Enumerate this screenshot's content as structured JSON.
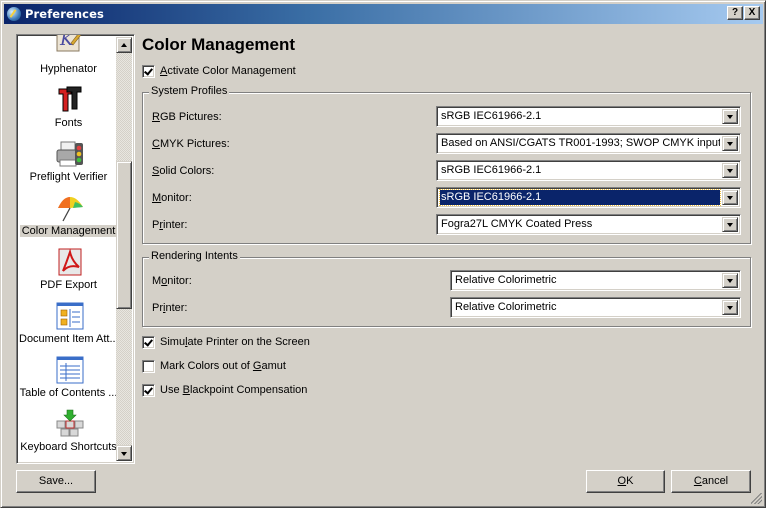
{
  "window": {
    "title": "Preferences",
    "help_button": "?",
    "close_button": "X"
  },
  "sidebar": {
    "items": [
      {
        "label": "Hyphenator",
        "icon": "hyphenator-icon"
      },
      {
        "label": "Fonts",
        "icon": "fonts-icon"
      },
      {
        "label": "Preflight Verifier",
        "icon": "preflight-verifier-icon"
      },
      {
        "label": "Color Management",
        "icon": "color-management-icon",
        "selected": true
      },
      {
        "label": "PDF Export",
        "icon": "pdf-export-icon"
      },
      {
        "label": "Document Item Att...",
        "icon": "document-item-attributes-icon"
      },
      {
        "label": "Table of Contents ...",
        "icon": "table-of-contents-icon"
      },
      {
        "label": "Keyboard Shortcuts",
        "icon": "keyboard-shortcuts-icon"
      }
    ]
  },
  "main": {
    "title": "Color Management",
    "activate": {
      "label_pre": "",
      "label_u": "A",
      "label_post": "ctivate Color Management",
      "checked": true
    },
    "system_profiles": {
      "title": "System Profiles",
      "rows": [
        {
          "label_u": "R",
          "label_post": "GB Pictures:",
          "value": "sRGB IEC61966-2.1"
        },
        {
          "label_u": "C",
          "label_post": "MYK Pictures:",
          "value": "Based on ANSI/CGATS TR001-1993; SWOP CMYK input"
        },
        {
          "label_u": "S",
          "label_post": "olid Colors:",
          "value": "sRGB IEC61966-2.1"
        },
        {
          "label_u": "M",
          "label_post": "onitor:",
          "value": "sRGB IEC61966-2.1",
          "focused": true
        },
        {
          "label_pre": "P",
          "label_u": "r",
          "label_post": "inter:",
          "value": "Fogra27L CMYK Coated Press"
        }
      ]
    },
    "rendering_intents": {
      "title": "Rendering Intents",
      "rows": [
        {
          "label_pre": "M",
          "label_u": "o",
          "label_post": "nitor:",
          "value": "Relative Colorimetric"
        },
        {
          "label_pre": "Pr",
          "label_u": "i",
          "label_post": "nter:",
          "value": "Relative Colorimetric"
        }
      ]
    },
    "options": [
      {
        "label_pre": "Simu",
        "label_u": "l",
        "label_post": "ate Printer on the Screen",
        "checked": true
      },
      {
        "label_pre": "Mark Colors out of ",
        "label_u": "G",
        "label_post": "amut",
        "checked": false
      },
      {
        "label_pre": "Use ",
        "label_u": "B",
        "label_post": "lackpoint Compensation",
        "checked": true
      }
    ]
  },
  "footer": {
    "save_label": "Save...",
    "ok_u": "O",
    "ok_post": "K",
    "cancel_u": "C",
    "cancel_post": "ancel"
  },
  "colors": {
    "titlebar_start": "#0a246a",
    "titlebar_end": "#a6caf0",
    "face": "#d4d0c8",
    "selection": "#0a246a"
  }
}
